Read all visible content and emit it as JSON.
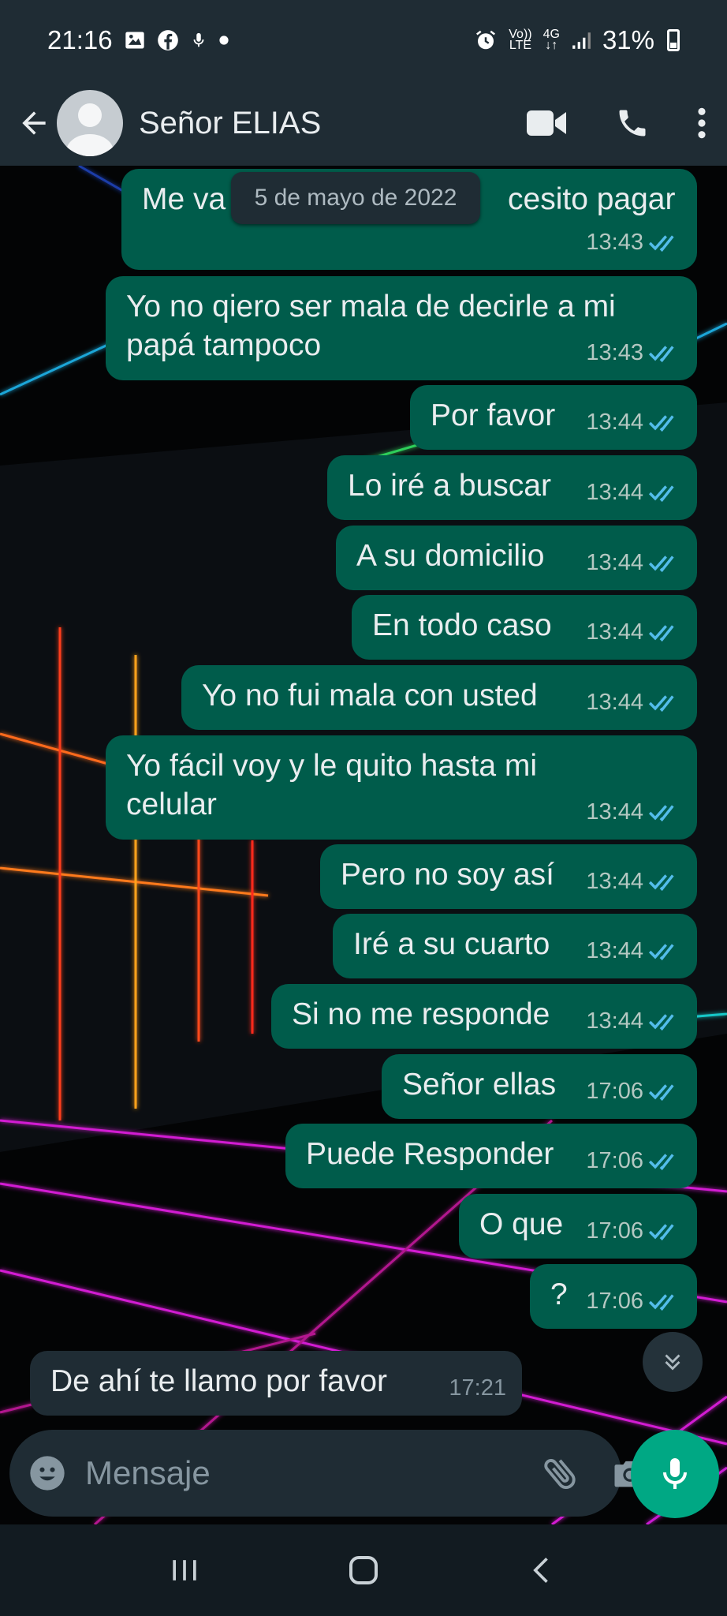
{
  "status_bar": {
    "time": "21:16",
    "volte_line1": "Vo))",
    "volte_line2": "LTE",
    "network": "4G",
    "battery": "31%",
    "battery_level": 0.31,
    "icons": [
      "gallery-icon",
      "facebook-icon",
      "mic-icon",
      "dot-icon",
      "alarm-icon",
      "volte-icon",
      "network-4g-icon",
      "signal-icon",
      "battery-icon"
    ]
  },
  "header": {
    "contact_name": "Señor ELIAS",
    "icons": [
      "back-arrow-icon",
      "avatar-icon",
      "video-call-icon",
      "phone-icon",
      "more-vertical-icon"
    ]
  },
  "date_pill": "5 de mayo de 2022",
  "messages": [
    {
      "text": "Me va",
      "text2": "cesito pagar",
      "time": "13:43",
      "dir": "out"
    },
    {
      "text": "Yo no qiero ser mala de decirle a mi",
      "text2": "papá tampoco",
      "time": "13:43",
      "dir": "out"
    },
    {
      "text": "Por favor",
      "time": "13:44",
      "dir": "out"
    },
    {
      "text": "Lo iré a buscar",
      "time": "13:44",
      "dir": "out"
    },
    {
      "text": "A su domicilio",
      "time": "13:44",
      "dir": "out"
    },
    {
      "text": "En todo caso",
      "time": "13:44",
      "dir": "out"
    },
    {
      "text": "Yo no fui mala con usted",
      "time": "13:44",
      "dir": "out"
    },
    {
      "text": "Yo fácil voy y le quito hasta mi",
      "text2": "celular",
      "time": "13:44",
      "dir": "out"
    },
    {
      "text": "Pero no soy así",
      "time": "13:44",
      "dir": "out"
    },
    {
      "text": "Iré a su cuarto",
      "time": "13:44",
      "dir": "out"
    },
    {
      "text": "Si no me responde",
      "time": "13:44",
      "dir": "out"
    },
    {
      "text": "Señor ellas",
      "time": "17:06",
      "dir": "out"
    },
    {
      "text": "Puede Responder",
      "time": "17:06",
      "dir": "out"
    },
    {
      "text": "O que",
      "time": "17:06",
      "dir": "out"
    },
    {
      "text": "?",
      "time": "17:06",
      "dir": "out"
    },
    {
      "text": "De ahí te  llamo por favor",
      "time": "17:21",
      "dir": "in"
    }
  ],
  "input": {
    "placeholder": "Mensaje",
    "value": ""
  },
  "colors": {
    "header_bg": "#1f2c34",
    "outgoing_bubble": "#005c4b",
    "incoming_bubble": "#1f2c34",
    "read_ticks": "#53bdeb",
    "mic_button": "#00a884"
  }
}
